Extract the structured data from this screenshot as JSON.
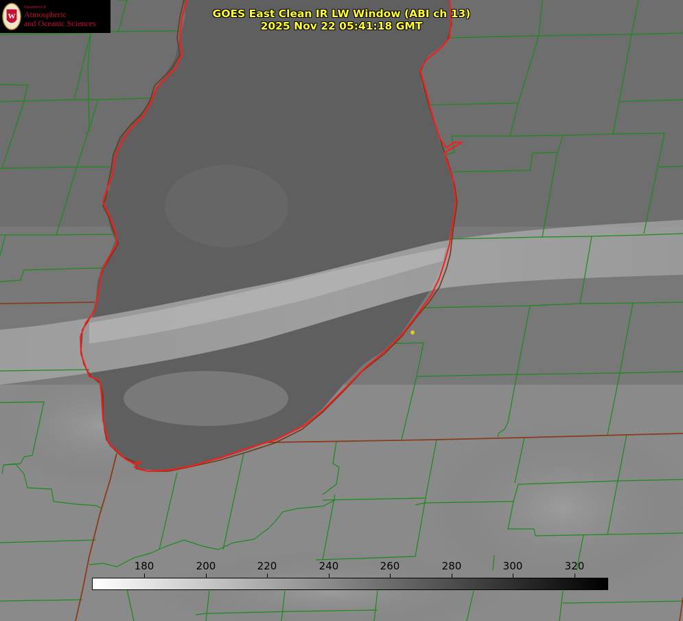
{
  "title": {
    "line1": "GOES East Clean IR LW Window (ABI ch 13)",
    "line2": "2025 Nov 22 05:41:18 GMT"
  },
  "logo": {
    "dept": "Department of",
    "line1": "Atmospheric",
    "line2": "and Oceanic Sciences",
    "seal_letter": "W"
  },
  "colorbar": {
    "unit_range": [
      163,
      331
    ],
    "ticks": [
      "180",
      "200",
      "220",
      "240",
      "260",
      "280",
      "300",
      "320"
    ],
    "start_color": "#ffffff",
    "end_color": "#000000"
  },
  "colors": {
    "county_lines": "#1a8a1a",
    "state_lines": "#8b3a1a",
    "lake_outline": "#ff2020",
    "title_text": "#ffff33",
    "marker": "#ddcc22"
  }
}
